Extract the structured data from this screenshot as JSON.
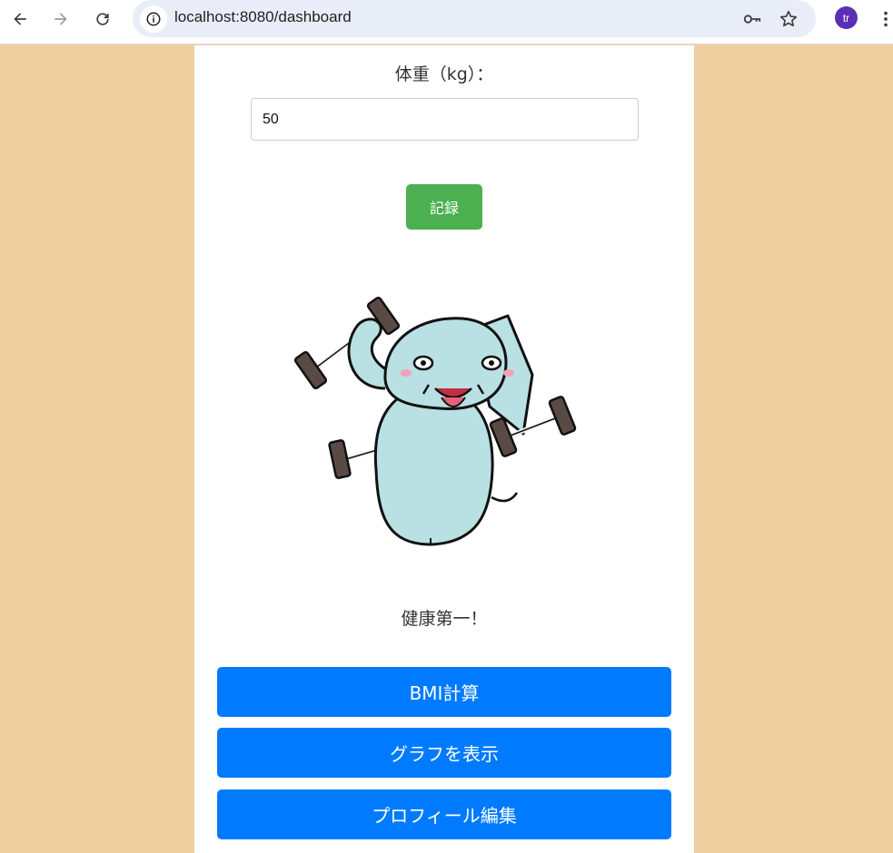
{
  "browser": {
    "url": "localhost:8080/dashboard",
    "avatar_initials": "tr"
  },
  "form": {
    "weight_label": "体重（kg）：",
    "weight_value": "50",
    "record_button": "記録"
  },
  "motto": "健康第一！",
  "actions": {
    "bmi": "BMI計算",
    "graph": "グラフを表示",
    "profile": "プロフィール編集"
  },
  "colors": {
    "page_background": "#efcf9f",
    "record_button": "#4caf50",
    "action_button": "#007bff",
    "avatar": "#5b2fb4"
  },
  "icons": [
    "back-icon",
    "forward-icon",
    "reload-icon",
    "site-info-icon",
    "key-icon",
    "star-icon",
    "kebab-menu-icon",
    "elephant-illustration"
  ]
}
